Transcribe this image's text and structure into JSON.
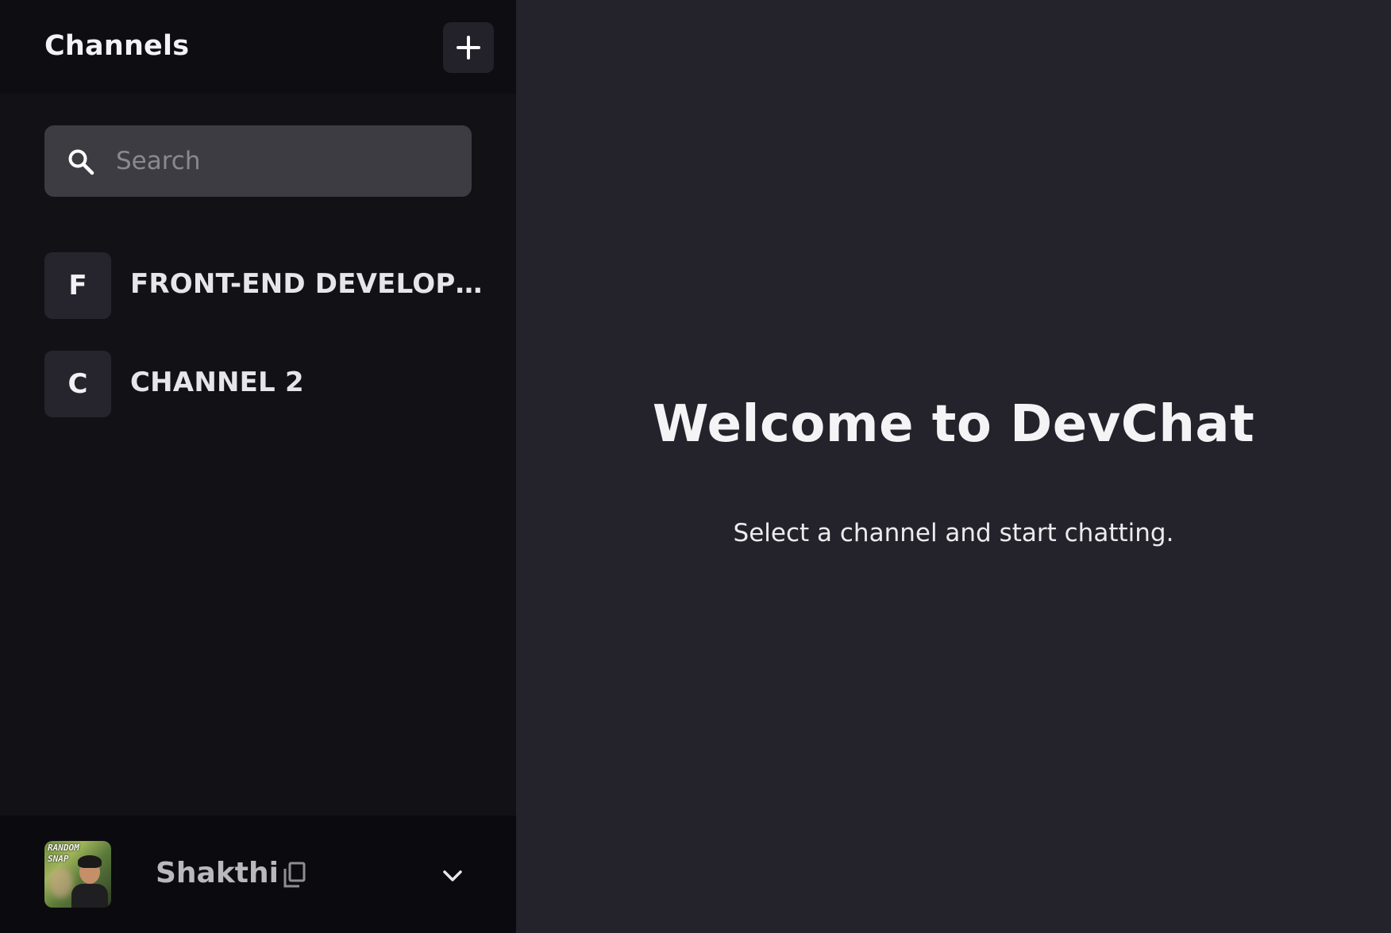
{
  "sidebar": {
    "title": "Channels",
    "add_button_icon": "plus-icon",
    "search": {
      "placeholder": "Search",
      "value": "",
      "icon": "search-icon"
    },
    "channels": [
      {
        "initial": "F",
        "name": "FRONT-END DEVELOPERS"
      },
      {
        "initial": "C",
        "name": "CHANNEL 2"
      }
    ],
    "user": {
      "name": "Shakthi",
      "avatar_caption": "RANDOM SNAP",
      "copy_icon": "copy-icon",
      "menu_icon": "chevron-down-icon"
    }
  },
  "main": {
    "welcome_title": "Welcome to DevChat",
    "welcome_subtitle": "Select a channel and start chatting."
  },
  "colors": {
    "sidebar_bg": "#121116",
    "sidebar_header_bg": "#0e0d11",
    "footer_bg": "#0b0a0e",
    "main_bg": "#24232b",
    "search_bg": "#3d3c43",
    "channel_avatar_bg": "#26252d",
    "text_primary": "#f4f4f6"
  }
}
